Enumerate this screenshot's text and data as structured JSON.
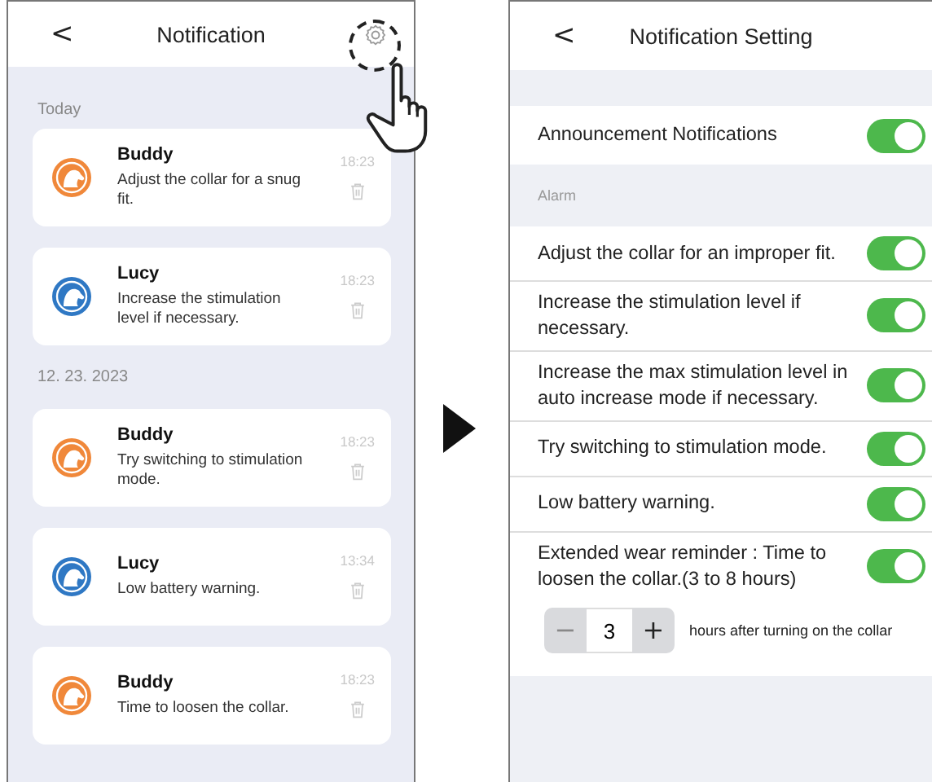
{
  "notification_screen": {
    "back": "<",
    "title": "Notification",
    "groups": [
      {
        "date": "Today",
        "items": [
          {
            "name": "Buddy",
            "message": "Adjust the collar for a snug fit.",
            "time": "18:23",
            "color": "#f0883a"
          },
          {
            "name": "Lucy",
            "message": "Increase the stimulation level if necessary.",
            "time": "18:23",
            "color": "#2f78c4"
          }
        ]
      },
      {
        "date": "12. 23. 2023",
        "items": [
          {
            "name": "Buddy",
            "message": "Try switching to stimulation mode.",
            "time": "18:23",
            "color": "#f0883a"
          },
          {
            "name": "Lucy",
            "message": "Low battery warning.",
            "time": "13:34",
            "color": "#2f78c4"
          },
          {
            "name": "Buddy",
            "message": "Time to loosen the collar.",
            "time": "18:23",
            "color": "#f0883a"
          }
        ]
      }
    ]
  },
  "setting_screen": {
    "back": "<",
    "title": "Notification Setting",
    "announcement": {
      "label": "Announcement Notifications",
      "on": true
    },
    "section": "Alarm",
    "alarms": [
      {
        "label": "Adjust the collar for an improper fit.",
        "on": true
      },
      {
        "label": "Increase the stimulation level if necessary.",
        "on": true
      },
      {
        "label": "Increase the max stimulation level in auto increase mode if necessary.",
        "on": true
      },
      {
        "label": "Try switching to stimulation mode.",
        "on": true
      },
      {
        "label": "Low battery warning.",
        "on": true
      },
      {
        "label": "Extended wear reminder : Time to loosen the collar.(3 to 8 hours)",
        "on": true
      }
    ],
    "stepper": {
      "minus": "−",
      "value": "3",
      "plus": "+",
      "caption": "hours after turning on the collar"
    }
  }
}
